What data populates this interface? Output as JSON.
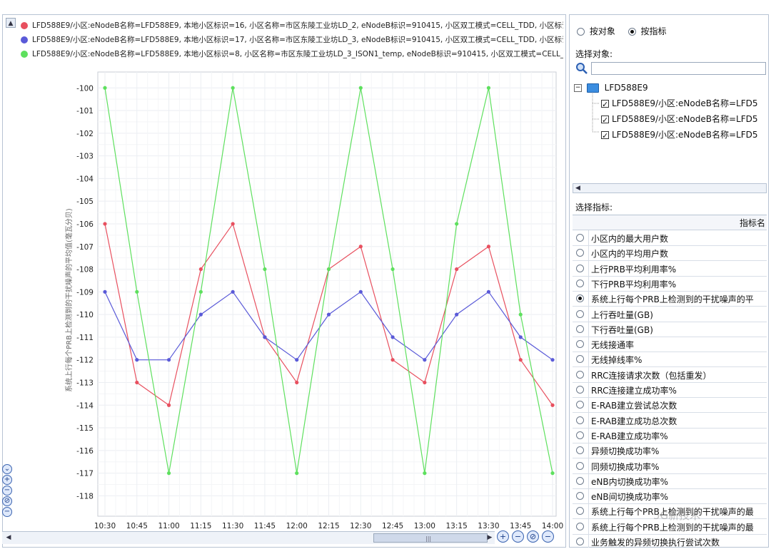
{
  "legend": [
    {
      "text": "LFD588E9/小区:eNodeB名称=LFD588E9, 本地小区标识=16, 小区名称=市区东陵工业坊LD_2, eNodeB标识=910415, 小区双工模式=CELL_TDD, 小区标识=",
      "color": "#e8505f"
    },
    {
      "text": "LFD588E9/小区:eNodeB名称=LFD588E9, 本地小区标识=17, 小区名称=市区东陵工业坊LD_3, eNodeB标识=910415, 小区双工模式=CELL_TDD, 小区标识=",
      "color": "#5a5ad8"
    },
    {
      "text": "LFD588E9/小区:eNodeB名称=LFD588E9, 本地小区标识=8, 小区名称=市区东陵工业坊LD_3_ISON1_temp, eNodeB标识=910415, 小区双工模式=CELL_TD",
      "color": "#5ee05e"
    }
  ],
  "chart_data": {
    "type": "line",
    "ylabel": "系统上行每个PRB上检测到的干扰噪声的平均值(毫瓦分贝)",
    "xlabel": "",
    "categories": [
      "10:30",
      "10:45",
      "11:00",
      "11:15",
      "11:30",
      "11:45",
      "12:00",
      "12:15",
      "12:30",
      "12:45",
      "13:00",
      "13:15",
      "13:30",
      "13:45",
      "14:00"
    ],
    "ylim": [
      -118.9,
      -99.3
    ],
    "yticks": [
      -100,
      -101,
      -102,
      -103,
      -104,
      -105,
      -106,
      -107,
      -108,
      -109,
      -110,
      -111,
      -112,
      -113,
      -114,
      -115,
      -116,
      -117,
      -118
    ],
    "grid": true,
    "series": [
      {
        "name": "LFD588E9/小区:eNodeB名称=LFD588E9, 本地小区标识=16, 小区名称=市区东陵工业坊LD_2",
        "color": "#e8505f",
        "values": [
          -106,
          -113,
          -114,
          -108,
          -106,
          -111,
          -113,
          -108,
          -107,
          -112,
          -113,
          -108,
          -107,
          -112,
          -114
        ]
      },
      {
        "name": "LFD588E9/小区:eNodeB名称=LFD588E9, 本地小区标识=17, 小区名称=市区东陵工业坊LD_3",
        "color": "#5a5ad8",
        "values": [
          -109,
          -112,
          -112,
          -110,
          -109,
          -111,
          -112,
          -110,
          -109,
          -111,
          -112,
          -110,
          -109,
          -111,
          -112
        ]
      },
      {
        "name": "LFD588E9/小区:eNodeB名称=LFD588E9, 本地小区标识=8, 小区名称=市区东陵工业坊LD_3_ISON1_temp",
        "color": "#5ee05e",
        "values": [
          -100,
          -109,
          -117,
          -109,
          -100,
          -108,
          -117,
          -108,
          -100,
          -108,
          -117,
          -106,
          -100,
          -110,
          -117
        ]
      }
    ]
  },
  "right": {
    "mode_by_object": "按对象",
    "mode_by_metric": "按指标",
    "select_object_label": "选择对象:",
    "tree_root": "LFD588E9",
    "tree_items": [
      "LFD588E9/小区:eNodeB名称=LFD5",
      "LFD588E9/小区:eNodeB名称=LFD5",
      "LFD588E9/小区:eNodeB名称=LFD5"
    ],
    "select_metric_label": "选择指标:",
    "metric_header": "指标名",
    "metrics": [
      {
        "label": "小区内的最大用户数",
        "selected": false
      },
      {
        "label": "小区内的平均用户数",
        "selected": false
      },
      {
        "label": "上行PRB平均利用率%",
        "selected": false
      },
      {
        "label": "下行PRB平均利用率%",
        "selected": false
      },
      {
        "label": "系统上行每个PRB上检测到的干扰噪声的平",
        "selected": true
      },
      {
        "label": "上行吞吐量(GB)",
        "selected": false
      },
      {
        "label": "下行吞吐量(GB)",
        "selected": false
      },
      {
        "label": "无线接通率",
        "selected": false
      },
      {
        "label": "无线掉线率%",
        "selected": false
      },
      {
        "label": "RRC连接请求次数（包括重发）",
        "selected": false
      },
      {
        "label": "RRC连接建立成功率%",
        "selected": false
      },
      {
        "label": "E-RAB建立尝试总次数",
        "selected": false
      },
      {
        "label": "E-RAB建立成功总次数",
        "selected": false
      },
      {
        "label": "E-RAB建立成功率%",
        "selected": false
      },
      {
        "label": "异频切换成功率%",
        "selected": false
      },
      {
        "label": "同频切换成功率%",
        "selected": false
      },
      {
        "label": "eNB内切换成功率%",
        "selected": false
      },
      {
        "label": "eNB间切换成功率%",
        "selected": false
      },
      {
        "label": "系统上行每个PRB上检测到的干扰噪声的最",
        "selected": false
      },
      {
        "label": "系统上行每个PRB上检测到的干扰噪声的最",
        "selected": false
      },
      {
        "label": "业务触发的异频切换执行尝试次数",
        "selected": false
      }
    ]
  },
  "watermark": "5G新技术",
  "icons": {
    "collapse": "chevron-up-icon",
    "zoom_in": "zoom-in-icon",
    "zoom_out": "zoom-out-icon",
    "zoom_reset": "zoom-reset-icon",
    "search": "search-icon",
    "folder": "folder-icon"
  }
}
